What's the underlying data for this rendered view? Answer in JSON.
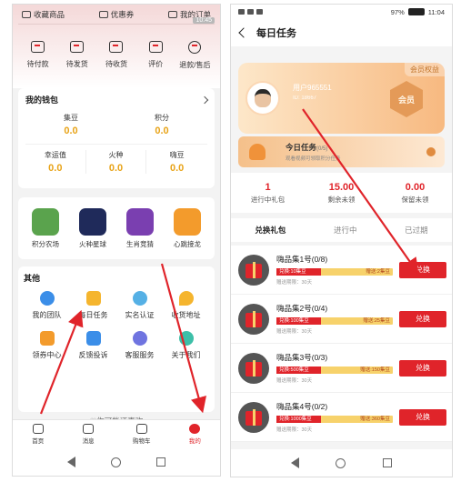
{
  "left": {
    "top_tabs": [
      "收藏商品",
      "优惠券",
      "我的订单"
    ],
    "status_time": "10:45",
    "orders": [
      "待付款",
      "待发货",
      "待收货",
      "评价",
      "退款/售后"
    ],
    "wallet": {
      "title": "我的钱包",
      "row1": [
        {
          "k": "集豆",
          "v": "0.0"
        },
        {
          "k": "积分",
          "v": "0.0"
        }
      ],
      "row2": [
        {
          "k": "幸运值",
          "v": "0.0"
        },
        {
          "k": "火种",
          "v": "0.0"
        },
        {
          "k": "嗨豆",
          "v": "0.0"
        }
      ]
    },
    "games": [
      {
        "label": "积分农场",
        "color": "#5aa34d"
      },
      {
        "label": "火种星球",
        "color": "#1f2a5a"
      },
      {
        "label": "生肖竞猜",
        "color": "#7a3fb0"
      },
      {
        "label": "心跳接龙",
        "color": "#f39b2c"
      }
    ],
    "others_title": "其他",
    "others": [
      {
        "label": "我的团队",
        "color": "#3b8ee8"
      },
      {
        "label": "每日任务",
        "color": "#f5b52e"
      },
      {
        "label": "实名认证",
        "color": "#55b0e5"
      },
      {
        "label": "收货地址",
        "color": "#f5b52e"
      },
      {
        "label": "领券中心",
        "color": "#f39b2c"
      },
      {
        "label": "反馈投诉",
        "color": "#3b8ee8"
      },
      {
        "label": "客服服务",
        "color": "#6f74e0"
      },
      {
        "label": "关于我们",
        "color": "#3dbfa8"
      }
    ],
    "maybe_like": "——♡你可能还喜欢——",
    "nav": [
      "首页",
      "消息",
      "购物车",
      "我的"
    ]
  },
  "right": {
    "status_time": "11:04",
    "status_battery": "97%",
    "title": "每日任务",
    "member_tag": "会员权益",
    "username": "用户965551",
    "user_id": "ID: 18667",
    "badge": "会员",
    "task_title": "今日任务",
    "task_count": "(0/5)",
    "task_hint": "观看视频可领取积分任务",
    "stats": [
      {
        "n": "1",
        "d": "进行中礼包"
      },
      {
        "n": "15.00",
        "d": "剩余未领"
      },
      {
        "n": "0.00",
        "d": "保留未领"
      }
    ],
    "tabs": [
      "兑换礼包",
      "进行中",
      "已过期"
    ],
    "redeem_label": "兑换",
    "items": [
      {
        "name": "嗨品集1号",
        "progress": "(0/8)",
        "left": "兑换:10集豆",
        "right": "赠送:2集豆",
        "expire": "赠送期限：30天"
      },
      {
        "name": "嗨品集2号",
        "progress": "(0/4)",
        "left": "兑换:100集豆",
        "right": "赠送:25集豆",
        "expire": "赠送期限：30天"
      },
      {
        "name": "嗨品集3号",
        "progress": "(0/3)",
        "left": "兑换:500集豆",
        "right": "赠送:150集豆",
        "expire": "赠送期限：30天"
      },
      {
        "name": "嗨品集4号",
        "progress": "(0/2)",
        "left": "兑换:1000集豆",
        "right": "赠送:360集豆",
        "expire": "赠送期限：30天"
      }
    ]
  }
}
